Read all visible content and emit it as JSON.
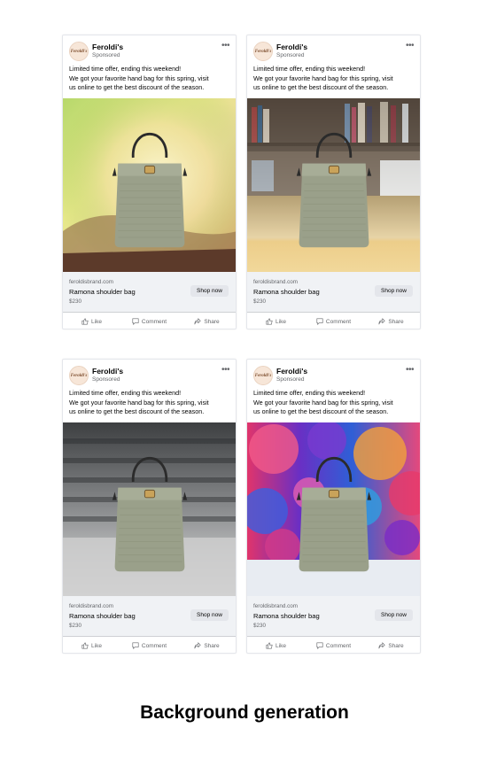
{
  "ad": {
    "advertiser": "Feroldi's",
    "avatar_text": "Feroldi's",
    "sponsored_label": "Sponsored",
    "more_icon": "more-horizontal-icon",
    "copy_lines": [
      "Limited time offer, ending this weekend!",
      "We got your favorite hand bag for this spring, visit",
      "us online to get the best discount of the season."
    ],
    "domain": "feroldisbrand.com",
    "product_name": "Ramona shoulder bag",
    "price": "$230",
    "cta_label": "Shop now",
    "actions": [
      {
        "label": "Like",
        "icon": "thumbs-up-icon"
      },
      {
        "label": "Comment",
        "icon": "comment-icon"
      },
      {
        "label": "Share",
        "icon": "share-icon"
      }
    ]
  },
  "variants": [
    {
      "background": "abstract green-yellow gradient"
    },
    {
      "background": "wooden table bookshelf"
    },
    {
      "background": "grey concrete studio"
    },
    {
      "background": "colorful paint splash"
    }
  ],
  "caption": "Background generation"
}
